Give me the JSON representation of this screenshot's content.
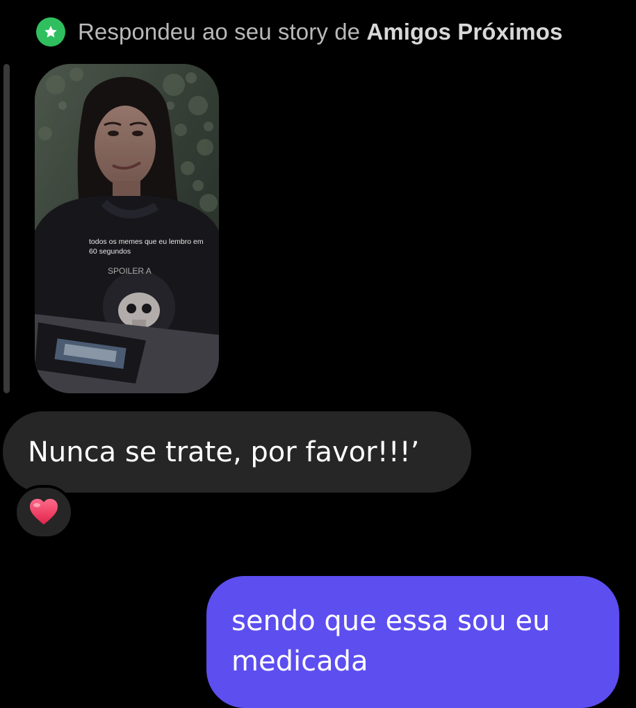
{
  "reply_header": {
    "prefix": "Respondeu ao seu story de ",
    "list_name": "Amigos Próximos",
    "icon": "star-icon",
    "badge_color": "#2fbf5f"
  },
  "story": {
    "caption": "todos os memes que eu lembro em 60 segundos",
    "shirt_text": "SPOILER A"
  },
  "messages": [
    {
      "direction": "incoming",
      "text": "Nunca se trate, por favor!!!’",
      "reaction": "❤️",
      "reaction_icon": "heart-icon"
    },
    {
      "direction": "outgoing",
      "text": "sendo que essa sou eu medicada",
      "bubble_color": "#5d4ef0"
    }
  ]
}
